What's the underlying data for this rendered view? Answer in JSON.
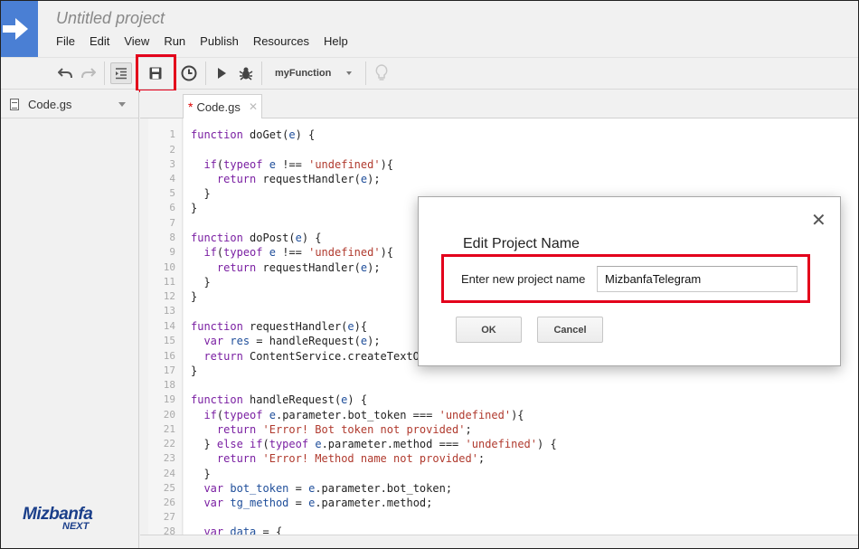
{
  "project": {
    "title": "Untitled project"
  },
  "menu": [
    "File",
    "Edit",
    "View",
    "Run",
    "Publish",
    "Resources",
    "Help"
  ],
  "toolbar": {
    "function_select": "myFunction",
    "icons": [
      "undo-icon",
      "redo-icon",
      "indent-icon",
      "save-icon",
      "triggers-icon",
      "run-icon",
      "debug-icon",
      "lightbulb-icon"
    ]
  },
  "sidebar": {
    "file_name": "Code.gs"
  },
  "editor": {
    "tab_label": "Code.gs",
    "tab_modified_marker": "*",
    "line_numbers": [
      "1",
      "2",
      "3",
      "4",
      "5",
      "6",
      "7",
      "8",
      "9",
      "10",
      "11",
      "12",
      "13",
      "14",
      "15",
      "16",
      "17",
      "18",
      "19",
      "20",
      "21",
      "22",
      "23",
      "24",
      "25",
      "26",
      "27",
      "28"
    ]
  },
  "dialog": {
    "title": "Edit Project Name",
    "label": "Enter new project name",
    "input_value": "MizbanfaTelegram",
    "ok_label": "OK",
    "cancel_label": "Cancel",
    "close_glyph": "✕"
  },
  "brand": {
    "line1": "Mizbanfa",
    "line2": "NEXT"
  },
  "colors": {
    "highlight": "#e3001b",
    "logo": "#4a7fd4",
    "keyword": "#7a1fa2",
    "string": "#b03a2e"
  }
}
